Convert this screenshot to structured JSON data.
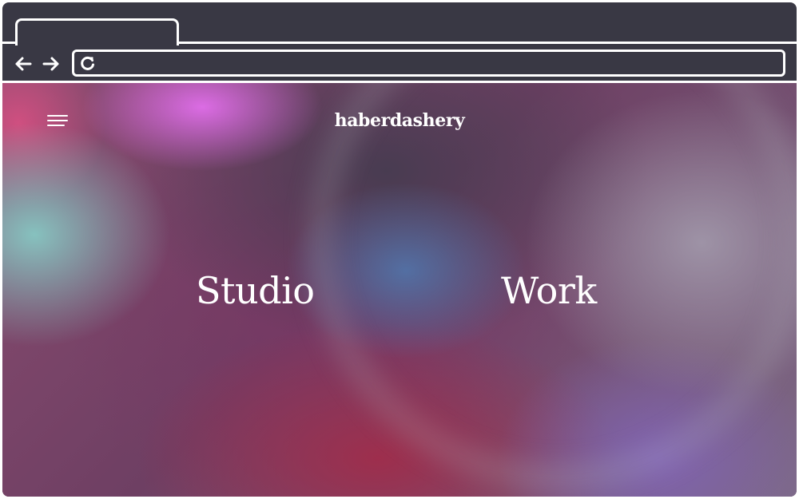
{
  "browser": {
    "tab_title": "",
    "url": "",
    "url_placeholder": "",
    "icons": {
      "back": "arrow-left-icon",
      "forward": "arrow-right-icon",
      "reload": "reload-icon"
    }
  },
  "page": {
    "logo": "haberdashery",
    "menu_icon": "hamburger-menu-icon",
    "nav": {
      "studio": "Studio",
      "work": "Work"
    }
  },
  "colors": {
    "chrome": "#393844",
    "chrome_outline": "#ffffff",
    "text": "#ffffff"
  }
}
